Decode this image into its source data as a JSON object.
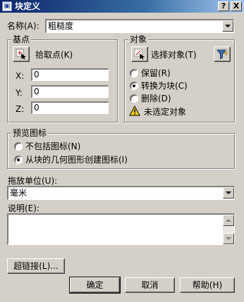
{
  "window": {
    "title": "块定义",
    "help_label": "?",
    "close_label": "X"
  },
  "name": {
    "label": "名称(A):",
    "value": "粗糙度"
  },
  "base_point": {
    "legend": "基点",
    "pick_label": "拾取点(K)",
    "x_label": "X:",
    "x_value": "0",
    "y_label": "Y:",
    "y_value": "0",
    "z_label": "Z:",
    "z_value": "0"
  },
  "objects": {
    "legend": "对象",
    "select_label": "选择对象(T)",
    "retain_label": "保留(R)",
    "convert_label": "转换为块(C)",
    "delete_label": "删除(D)",
    "warning_text": "未选定对象",
    "selected_option": "convert"
  },
  "preview": {
    "legend": "预览图标",
    "no_icon_label": "不包括图标(N)",
    "from_geometry_label": "从块的几何图形创建图标(I)",
    "selected_option": "from_geometry"
  },
  "insert_units": {
    "label": "拖放单位(U):",
    "value": "毫米"
  },
  "description": {
    "label": "说明(E):",
    "value": ""
  },
  "buttons": {
    "hyperlink": "超链接(L)...",
    "ok": "确定",
    "cancel": "取消",
    "help": "帮助(H)"
  },
  "colors": {
    "dialog_bg": "#d4d0c8",
    "titlebar_start": "#0a246a",
    "titlebar_end": "#a6caf0",
    "warning_yellow": "#f7d117"
  },
  "icons": [
    "block-definition-icon",
    "pick-point-icon",
    "select-objects-icon",
    "quick-select-filter-icon",
    "warning-icon"
  ]
}
